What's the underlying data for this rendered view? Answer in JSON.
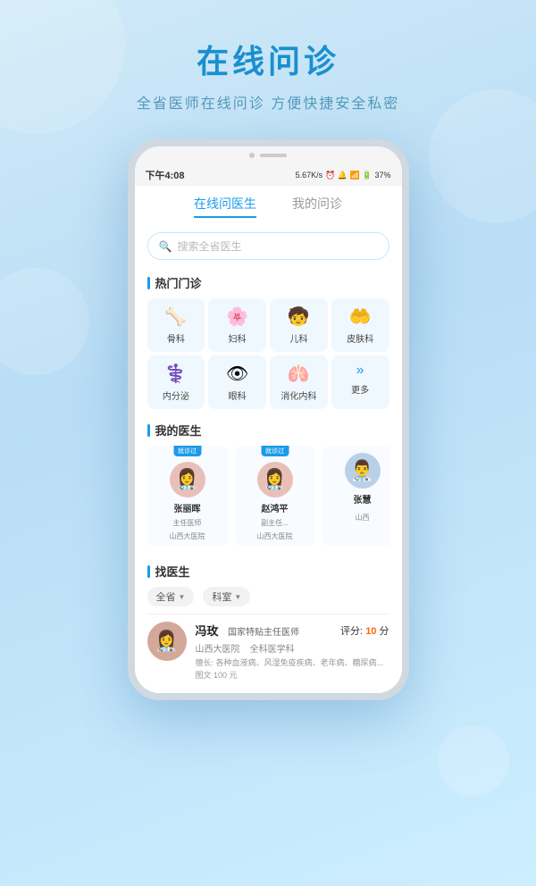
{
  "page": {
    "bg_title": "在线问诊",
    "bg_subtitle": "全省医师在线问诊  方便快捷安全私密"
  },
  "status_bar": {
    "time": "下午4:08",
    "network": "5.67K/s",
    "battery": "37%",
    "signal_icons": "📶"
  },
  "tabs": [
    {
      "id": "consult",
      "label": "在线问医生",
      "active": true
    },
    {
      "id": "my_consult",
      "label": "我的问诊",
      "active": false
    }
  ],
  "search": {
    "placeholder": "搜索全省医生"
  },
  "hot_dept": {
    "title": "热门门诊",
    "items": [
      {
        "id": "ortho",
        "icon": "🦴",
        "label": "骨科"
      },
      {
        "id": "gynecology",
        "icon": "👶",
        "label": "妇科"
      },
      {
        "id": "pediatrics",
        "icon": "🧒",
        "label": "儿科"
      },
      {
        "id": "dermatology",
        "icon": "👂",
        "label": "皮肤科"
      },
      {
        "id": "endocrine",
        "icon": "⚕",
        "label": "内分泌"
      },
      {
        "id": "ophthalmology",
        "icon": "👁",
        "label": "眼科"
      },
      {
        "id": "digestive",
        "icon": "🫃",
        "label": "消化内科"
      },
      {
        "id": "more",
        "icon": "»",
        "label": "更多"
      }
    ]
  },
  "my_doctors": {
    "title": "我的医生",
    "items": [
      {
        "id": "doc1",
        "name": "张丽晖",
        "title": "主任医师",
        "hospital": "山西大医院",
        "badge": "就诊过",
        "avatar_color": "#e05050",
        "avatar_text": "👩‍⚕️"
      },
      {
        "id": "doc2",
        "name": "赵鸿平",
        "title": "副主任...",
        "hospital": "山西大医院",
        "badge": "就诊过",
        "avatar_color": "#e05050",
        "avatar_text": "👩‍⚕️"
      },
      {
        "id": "doc3",
        "name": "张慧",
        "title": "",
        "hospital": "山西",
        "badge": "",
        "avatar_color": "#4488cc",
        "avatar_text": "👨‍⚕️"
      }
    ]
  },
  "find_doctor": {
    "title": "找医生",
    "filters": [
      {
        "id": "province",
        "label": "全省"
      },
      {
        "id": "dept",
        "label": "科室"
      }
    ],
    "doctors": [
      {
        "id": "fdoc1",
        "name": "冯玫",
        "title": "国家特贴主任医师",
        "hospital": "山西大医院",
        "dept": "全科医学科",
        "specialty": "擅长: 各种血液病、风湿免疫疾病、老年病、糖尿病...",
        "price": "图文 100 元",
        "score": "10",
        "avatar_text": "👩‍⚕️",
        "avatar_color": "#c8856a"
      }
    ]
  }
}
